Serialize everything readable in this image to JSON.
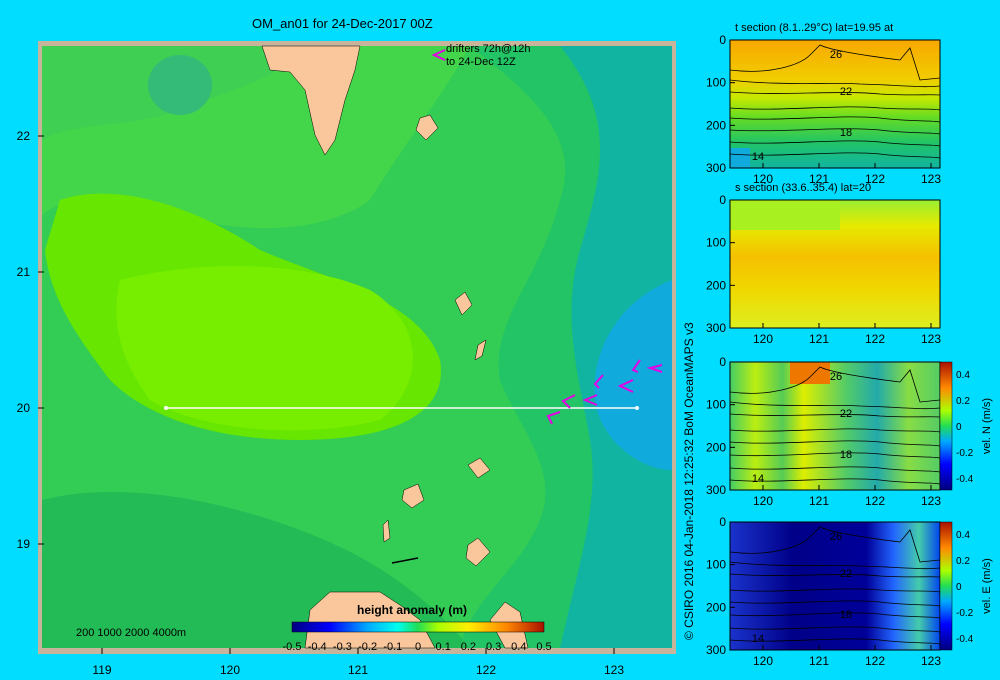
{
  "main_map": {
    "title": "OM_an01 for 24-Dec-2017 00Z",
    "drifter_note_line1": "drifters 72h@12h",
    "drifter_note_line2": "to 24-Dec 12Z",
    "depth_legend": "200  1000  2000  4000m",
    "colorbar_title": "height anomaly (m)",
    "colorbar_ticks": [
      "-0.5",
      "-0.4",
      "-0.3",
      "-0.2",
      "-0.1",
      "0",
      "0.1",
      "0.2",
      "0.3",
      "0.4",
      "0.5"
    ],
    "x_ticks": [
      "119",
      "120",
      "121",
      "122",
      "123"
    ],
    "y_ticks": [
      "22",
      "21",
      "20",
      "19"
    ],
    "section_line_lat": "20"
  },
  "credit": "© CSIRO 2016   04-Jan-2018 12:25:32 BoM OceanMAPS v3",
  "colors": {
    "background": "#00ddff",
    "frame": "#c8b49a",
    "land": "#f9c79b",
    "drifter": "#e600e6"
  },
  "chart_data": [
    {
      "type": "heatmap",
      "title": "t section (8.1..29°C) lat=19.95 at",
      "x_ticks": [
        "120",
        "121",
        "122",
        "123"
      ],
      "y_ticks": [
        "0",
        "100",
        "200",
        "300"
      ],
      "contour_labels": [
        "26",
        "22",
        "18",
        "14"
      ]
    },
    {
      "type": "heatmap",
      "title": "s section (33.6..35.4) lat=20",
      "x_ticks": [
        "120",
        "121",
        "122",
        "123"
      ],
      "y_ticks": [
        "0",
        "100",
        "200",
        "300"
      ]
    },
    {
      "type": "heatmap",
      "title": "",
      "x_ticks": [
        "120",
        "121",
        "122",
        "123"
      ],
      "y_ticks": [
        "0",
        "100",
        "200",
        "300"
      ],
      "contour_labels": [
        "26",
        "22",
        "18",
        "14"
      ],
      "colorbar_label": "vel. N (m/s)",
      "colorbar_ticks": [
        "0.4",
        "0.2",
        "0",
        "-0.2",
        "-0.4"
      ]
    },
    {
      "type": "heatmap",
      "title": "",
      "x_ticks": [
        "120",
        "121",
        "122",
        "123"
      ],
      "y_ticks": [
        "0",
        "100",
        "200",
        "300"
      ],
      "contour_labels": [
        "26",
        "22",
        "18",
        "14"
      ],
      "colorbar_label": "vel. E (m/s)",
      "colorbar_ticks": [
        "0.4",
        "0.2",
        "0",
        "-0.2",
        "-0.4"
      ]
    }
  ]
}
